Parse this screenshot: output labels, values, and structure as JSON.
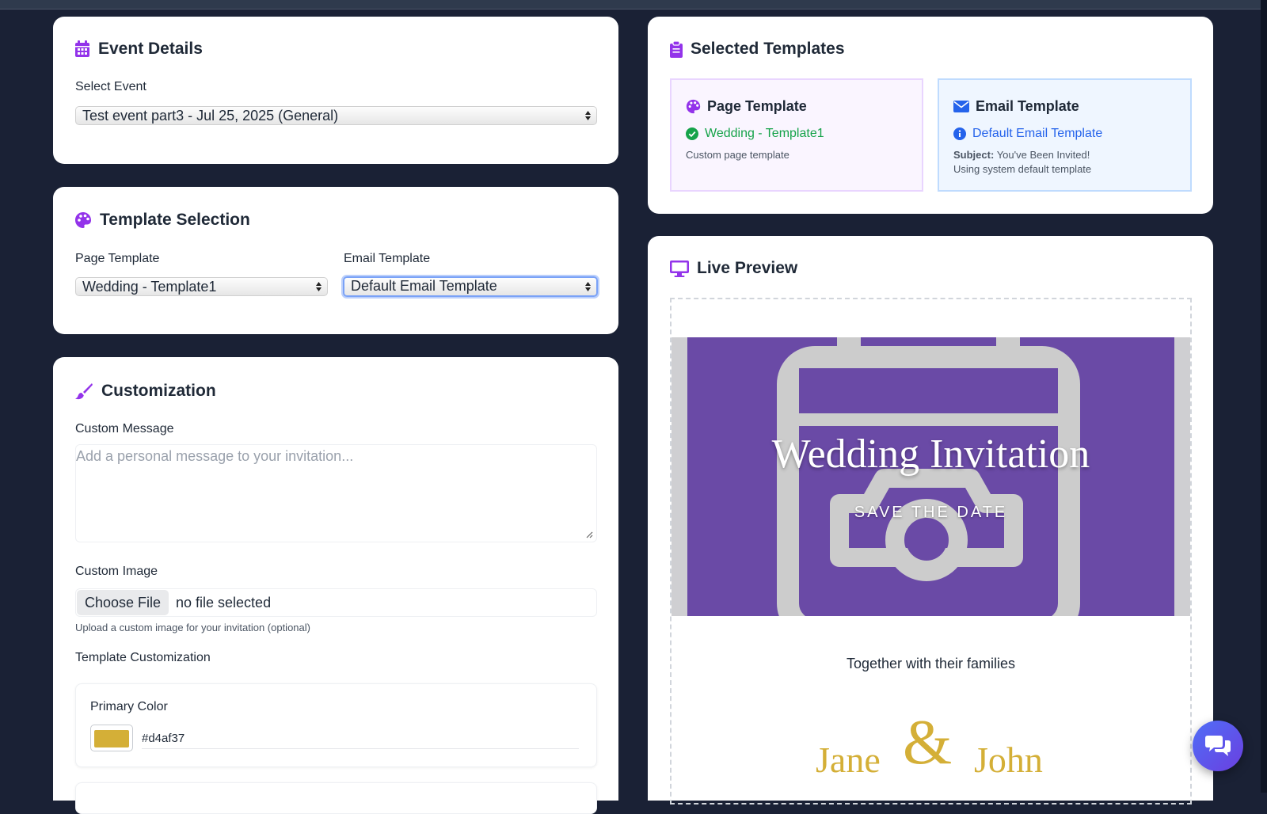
{
  "event_details": {
    "title": "Event Details",
    "select_label": "Select Event",
    "selected_event": "Test event part3 - Jul 25, 2025 (General)"
  },
  "template_selection": {
    "title": "Template Selection",
    "page_label": "Page Template",
    "page_value": "Wedding - Template1",
    "email_label": "Email Template",
    "email_value": "Default Email Template"
  },
  "customization": {
    "title": "Customization",
    "message_label": "Custom Message",
    "message_placeholder": "Add a personal message to your invitation...",
    "image_label": "Custom Image",
    "choose_file": "Choose File",
    "file_status": "no file selected",
    "image_help": "Upload a custom image for your invitation (optional)",
    "template_customization_label": "Template Customization",
    "primary_color_label": "Primary Color",
    "primary_color": "#d4af37"
  },
  "selected_templates": {
    "title": "Selected Templates",
    "page": {
      "title": "Page Template",
      "name": "Wedding - Template1",
      "note": "Custom page template"
    },
    "email": {
      "title": "Email Template",
      "name": "Default Email Template",
      "subject_label": "Subject:",
      "subject": "You've Been Invited!",
      "note": "Using system default template"
    }
  },
  "live_preview": {
    "title": "Live Preview",
    "hero_title": "Wedding Invitation",
    "hero_subtitle": "SAVE THE DATE",
    "families": "Together with their families",
    "name1": "Jane",
    "ampersand": "&",
    "name2": "John"
  },
  "colors": {
    "accent": "#9333ea",
    "success": "#16a34a",
    "info": "#2563eb",
    "hero_purple": "#6a4aa6",
    "gold": "#d4af37"
  },
  "icons": {
    "event_details": "calendar-icon",
    "template_selection": "palette-icon",
    "customization": "paint-brush-icon",
    "selected_templates": "clipboard-icon",
    "live_preview": "monitor-icon",
    "page_template": "palette-icon",
    "email_template": "envelope-icon",
    "page_status": "check-circle-icon",
    "email_status": "info-circle-icon",
    "hero": "image-placeholder-icon",
    "chat": "chat-bubbles-icon"
  }
}
